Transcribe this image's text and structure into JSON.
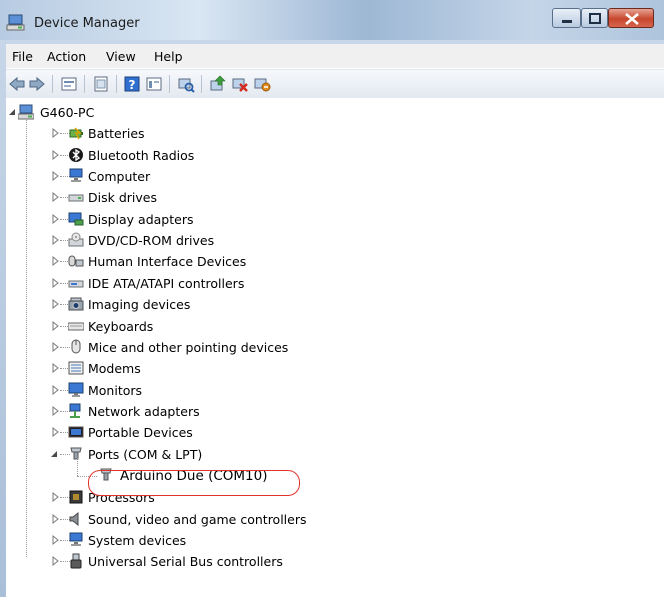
{
  "window": {
    "title": "Device Manager"
  },
  "menu": [
    "File",
    "Action",
    "View",
    "Help"
  ],
  "tree": {
    "root": "G460-PC",
    "items": [
      {
        "label": "Batteries",
        "icon": "battery-icon"
      },
      {
        "label": "Bluetooth Radios",
        "icon": "bluetooth-icon"
      },
      {
        "label": "Computer",
        "icon": "computer-icon"
      },
      {
        "label": "Disk drives",
        "icon": "disk-drive-icon"
      },
      {
        "label": "Display adapters",
        "icon": "display-adapter-icon"
      },
      {
        "label": "DVD/CD-ROM drives",
        "icon": "dvd-drive-icon"
      },
      {
        "label": "Human Interface Devices",
        "icon": "hid-icon"
      },
      {
        "label": "IDE ATA/ATAPI controllers",
        "icon": "ide-controller-icon"
      },
      {
        "label": "Imaging devices",
        "icon": "imaging-device-icon"
      },
      {
        "label": "Keyboards",
        "icon": "keyboard-icon"
      },
      {
        "label": "Mice and other pointing devices",
        "icon": "mouse-icon"
      },
      {
        "label": "Modems",
        "icon": "modem-icon"
      },
      {
        "label": "Monitors",
        "icon": "monitor-icon"
      },
      {
        "label": "Network adapters",
        "icon": "network-adapter-icon"
      },
      {
        "label": "Portable Devices",
        "icon": "portable-device-icon"
      },
      {
        "label": "Ports (COM & LPT)",
        "icon": "port-icon"
      },
      {
        "label": "Arduino Due (COM10)",
        "icon": "port-icon"
      },
      {
        "label": "Processors",
        "icon": "processor-icon"
      },
      {
        "label": "Sound, video and game controllers",
        "icon": "sound-icon"
      },
      {
        "label": "System devices",
        "icon": "system-device-icon"
      },
      {
        "label": "Universal Serial Bus controllers",
        "icon": "usb-icon"
      }
    ]
  },
  "colors": {
    "highlight": "#e0342b",
    "close": "#c7472e"
  }
}
